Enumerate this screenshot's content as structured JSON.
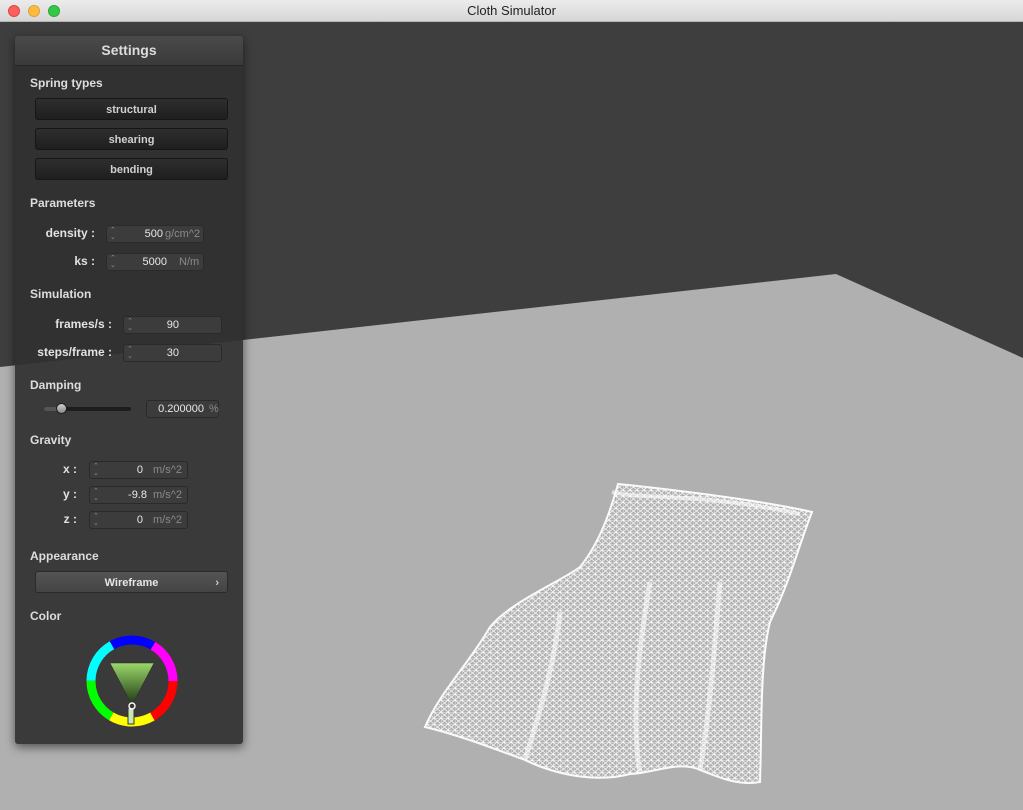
{
  "window": {
    "title": "Cloth Simulator",
    "controls": [
      "close",
      "minimize",
      "maximize"
    ]
  },
  "settings": {
    "title": "Settings",
    "spring_types": {
      "label": "Spring types",
      "buttons": [
        "structural",
        "shearing",
        "bending"
      ]
    },
    "parameters": {
      "label": "Parameters",
      "density": {
        "label": "density :",
        "value": "500",
        "unit": "g/cm^2"
      },
      "ks": {
        "label": "ks :",
        "value": "5000",
        "unit": "N/m"
      }
    },
    "simulation": {
      "label": "Simulation",
      "frames": {
        "label": "frames/s :",
        "value": "90"
      },
      "steps": {
        "label": "steps/frame :",
        "value": "30"
      }
    },
    "damping": {
      "label": "Damping",
      "value": "0.200000",
      "unit": "%",
      "slider_level": 0.2
    },
    "gravity": {
      "label": "Gravity",
      "x": {
        "label": "x :",
        "value": "0",
        "unit": "m/s^2"
      },
      "y": {
        "label": "y :",
        "value": "-9.8",
        "unit": "m/s^2"
      },
      "z": {
        "label": "z :",
        "value": "0",
        "unit": "m/s^2"
      }
    },
    "appearance": {
      "label": "Appearance",
      "selected": "Wireframe"
    },
    "color": {
      "label": "Color",
      "value": "#ffffff"
    }
  },
  "colors": {
    "sky": "#3e3e3e",
    "floor": "#b0b0b0",
    "cloth": "#ffffff",
    "panel_bg": "#303030"
  }
}
